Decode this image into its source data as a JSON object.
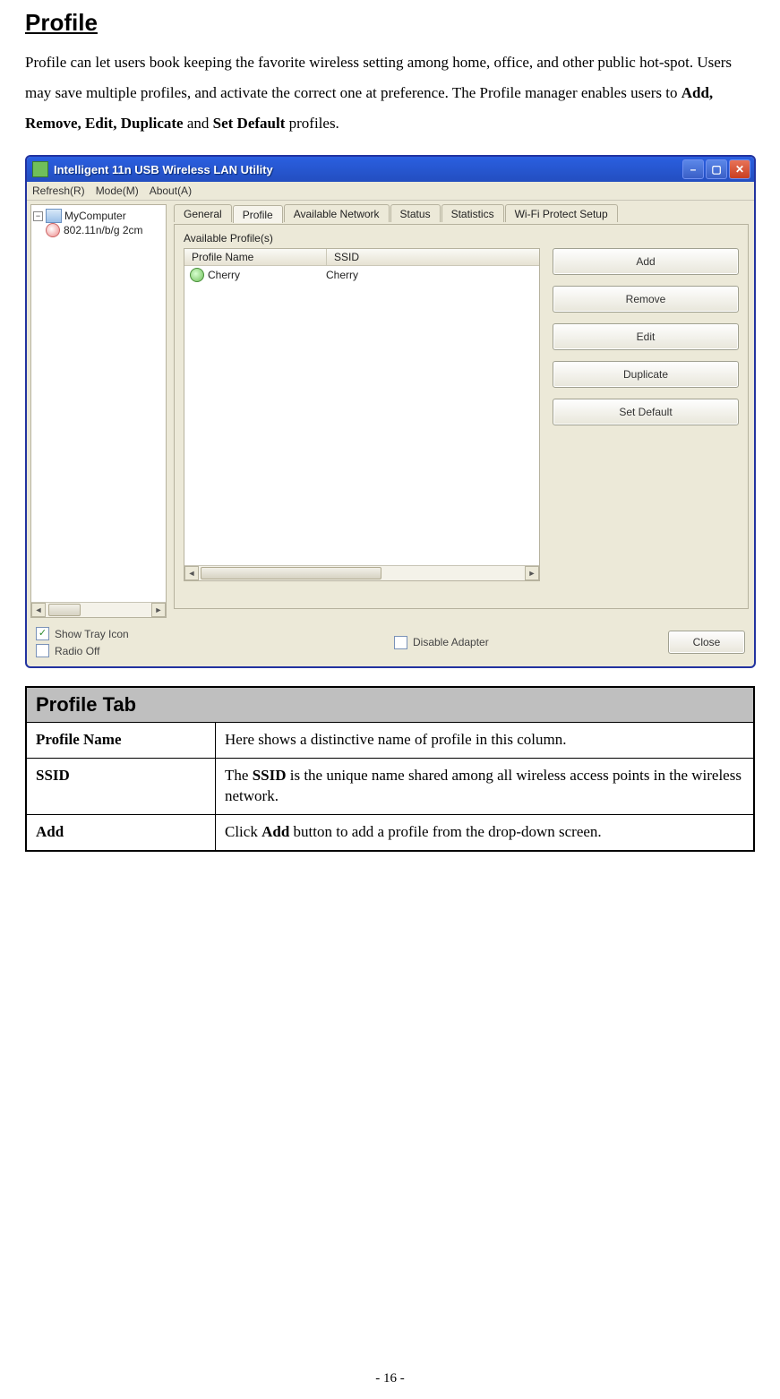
{
  "doc": {
    "heading": "Profile",
    "intro_plain_1": "Profile can let users book keeping the favorite wireless setting among home, office, and other public hot-spot. Users may save multiple profiles, and activate the correct one at preference. The Profile manager enables users to ",
    "intro_bold_1": "Add, Remove, Edit, Duplicate",
    "intro_plain_2": " and ",
    "intro_bold_2": "Set Default",
    "intro_plain_3": " profiles.",
    "page_number": "- 16 -"
  },
  "window": {
    "title": "Intelligent 11n USB Wireless LAN Utility",
    "menu": {
      "refresh": "Refresh(R)",
      "mode": "Mode(M)",
      "about": "About(A)"
    },
    "tree": {
      "root": "MyComputer",
      "adapter": "802.11n/b/g 2cm"
    },
    "tabs": {
      "general": "General",
      "profile": "Profile",
      "available_network": "Available Network",
      "status": "Status",
      "statistics": "Statistics",
      "wps": "Wi-Fi Protect Setup"
    },
    "group_label": "Available Profile(s)",
    "columns": {
      "profile_name": "Profile Name",
      "ssid": "SSID"
    },
    "row": {
      "profile_name": "Cherry",
      "ssid": "Cherry"
    },
    "actions": {
      "add": "Add",
      "remove": "Remove",
      "edit": "Edit",
      "duplicate": "Duplicate",
      "set_default": "Set Default"
    },
    "footer": {
      "show_tray": "Show Tray Icon",
      "radio_off": "Radio Off",
      "disable_adapter": "Disable Adapter",
      "close": "Close"
    }
  },
  "table": {
    "header": "Profile Tab",
    "rows": {
      "r1_key": "Profile Name",
      "r1_val": "Here shows a distinctive name of profile in this column.",
      "r2_key": "SSID",
      "r2_pre": "The ",
      "r2_bold": "SSID",
      "r2_post": " is the unique name shared among all wireless access points in the wireless network.",
      "r3_key": "Add",
      "r3_pre": "Click ",
      "r3_bold": "Add",
      "r3_post": " button to add a profile from the drop-down screen."
    }
  }
}
